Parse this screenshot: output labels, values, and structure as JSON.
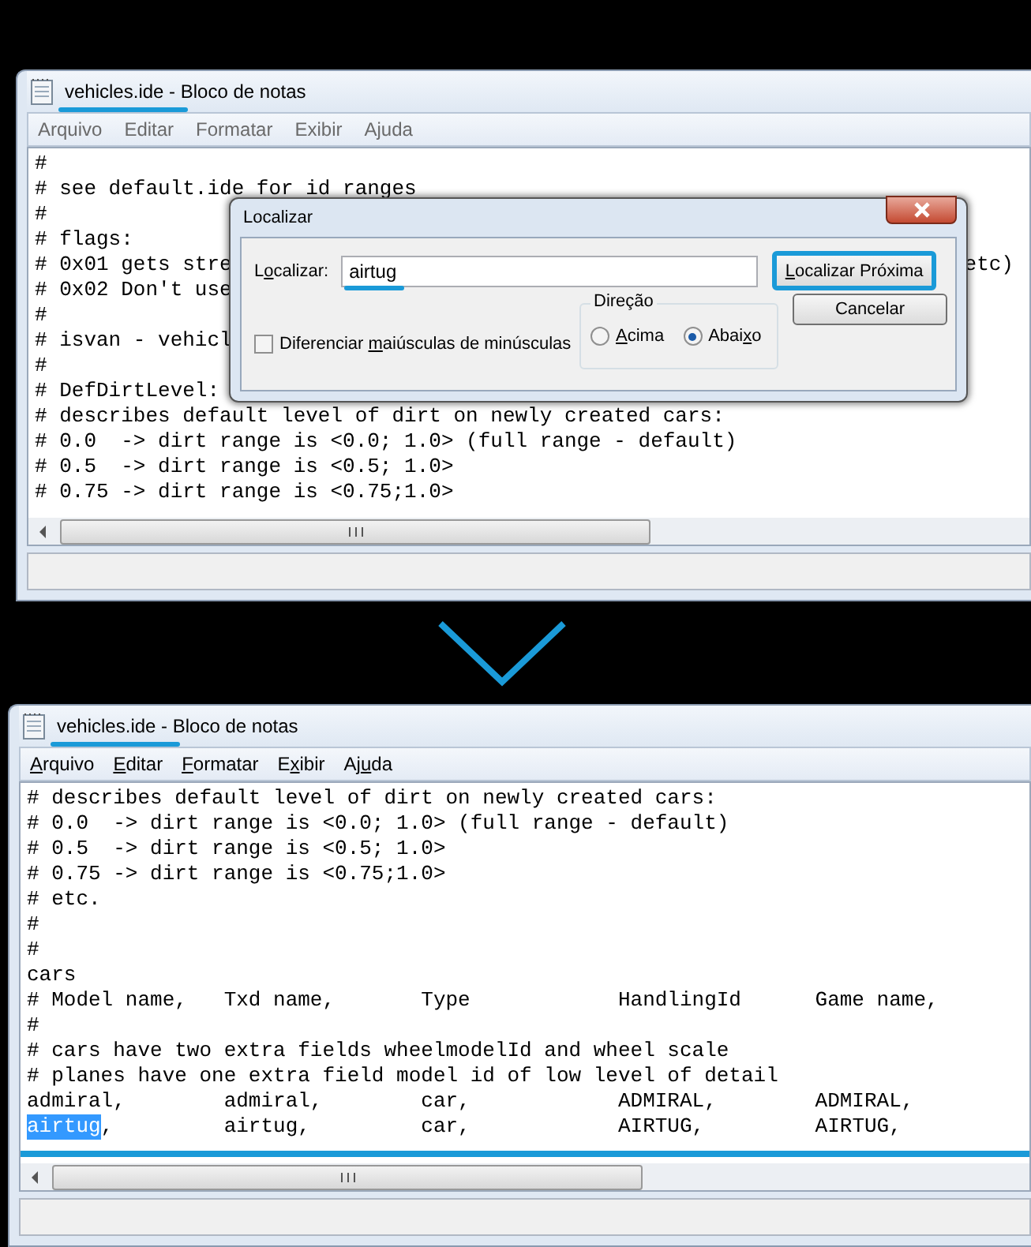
{
  "before": {
    "window": {
      "file": "vehicles.ide",
      "app": " - Bloco de notas"
    },
    "menu": [
      {
        "label": "Arquivo"
      },
      {
        "label": "Editar"
      },
      {
        "label": "Formatar"
      },
      {
        "label": "Exibir"
      },
      {
        "label": "Ajuda"
      }
    ],
    "lines": [
      {
        "text": "#"
      },
      {
        "text": "# see default.ide for id ranges"
      },
      {
        "text": "#"
      },
      {
        "text": "# flags:"
      },
      {
        "text": "# 0x01 gets stre",
        "right": "etc)"
      },
      {
        "text": "# 0x02 Don't use"
      },
      {
        "text": "#"
      },
      {
        "text": "# isvan - vehicl"
      },
      {
        "text": "#"
      },
      {
        "text": "# DefDirtLevel:"
      },
      {
        "text": "# describes default level of dirt on newly created cars:"
      },
      {
        "text": "# 0.0  -> dirt range is <0.0; 1.0> (full range - default)"
      },
      {
        "text": "# 0.5  -> dirt range is <0.5; 1.0>"
      },
      {
        "text": "# 0.75 -> dirt range is <0.75;1.0>"
      }
    ],
    "find_dialog": {
      "title": "Localizar",
      "find_label": {
        "before": "L",
        "key": "o",
        "after": "calizar:"
      },
      "find_value": "airtug",
      "find_next": {
        "key": "L",
        "after": "ocalizar Próxima"
      },
      "cancel": "Cancelar",
      "match_case": {
        "label": {
          "before": "Diferenciar ",
          "key": "m",
          "after": "aiúsculas de minúsculas"
        },
        "checked": false
      },
      "direction": {
        "label": "Direção",
        "options": [
          {
            "label": {
              "key": "A",
              "after": "cima"
            },
            "selected": false
          },
          {
            "label": {
              "before": "Abai",
              "key": "x",
              "after": "o"
            },
            "selected": true
          }
        ]
      }
    }
  },
  "after": {
    "window": {
      "file": "vehicles.ide",
      "app": " - Bloco de notas"
    },
    "menu": [
      {
        "key": "A",
        "after": "rquivo"
      },
      {
        "key": "E",
        "after": "ditar"
      },
      {
        "key": "F",
        "after": "ormatar"
      },
      {
        "before": "E",
        "key": "x",
        "after": "ibir"
      },
      {
        "before": "Aj",
        "key": "u",
        "after": "da"
      }
    ],
    "lines": [
      {
        "text": "# describes default level of dirt on newly created cars:"
      },
      {
        "text": "# 0.0  -> dirt range is <0.0; 1.0> (full range - default)"
      },
      {
        "text": "# 0.5  -> dirt range is <0.5; 1.0>"
      },
      {
        "text": "# 0.75 -> dirt range is <0.75;1.0>"
      },
      {
        "text": "# etc."
      },
      {
        "text": "#"
      },
      {
        "text": "#"
      },
      {
        "text": "cars"
      },
      {
        "text": "# Model name,   Txd name,       Type            HandlingId      Game name,"
      },
      {
        "text": "#"
      },
      {
        "text": "# cars have two extra fields wheelmodelId and wheel scale"
      },
      {
        "text": "# planes have one extra field model id of low level of detail"
      },
      {
        "text": "admiral,        admiral,        car,            ADMIRAL,        ADMIRAL,"
      },
      {
        "segments": [
          {
            "text": "airtug",
            "selected": true
          },
          {
            "text": ",         airtug,         car,            AIRTUG,         AIRTUG,",
            "selected": false
          }
        ]
      }
    ]
  }
}
